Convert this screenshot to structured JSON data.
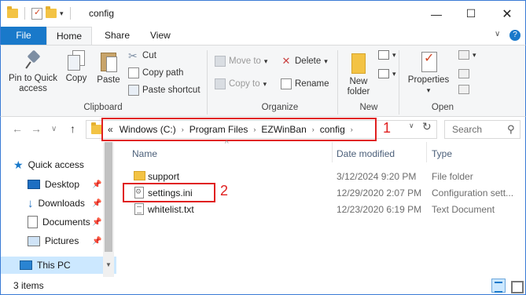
{
  "window": {
    "title": "config",
    "minimize_glyph": "—",
    "maximize_glyph": "☐",
    "close_glyph": "✕"
  },
  "ribbon": {
    "tabs": [
      {
        "label": "File"
      },
      {
        "label": "Home"
      },
      {
        "label": "Share"
      },
      {
        "label": "View"
      }
    ],
    "help_glyph": "?",
    "collapse_glyph": "∨",
    "groups": {
      "clipboard": {
        "label": "Clipboard",
        "pin_to_quick_access": "Pin to Quick access",
        "copy": "Copy",
        "paste": "Paste",
        "cut": "Cut",
        "copy_path": "Copy path",
        "paste_shortcut": "Paste shortcut"
      },
      "organize": {
        "label": "Organize",
        "move_to": "Move to",
        "copy_to": "Copy to",
        "delete": "Delete",
        "rename": "Rename"
      },
      "new": {
        "label": "New",
        "new_folder": "New folder"
      },
      "open": {
        "label": "Open",
        "properties": "Properties"
      }
    }
  },
  "navigation": {
    "back_glyph": "←",
    "forward_glyph": "→",
    "recent_glyph": "∨",
    "up_glyph": "↑",
    "breadcrumb_overflow": "«",
    "breadcrumb": [
      "Windows (C:)",
      "Program Files",
      "EZWinBan",
      "config"
    ],
    "refresh_glyph": "↻",
    "search_placeholder": "Search",
    "search_glyph": "⚲"
  },
  "annotations": {
    "marker_1": "1",
    "marker_2": "2",
    "color": "#e02020"
  },
  "nav_pane": {
    "items": [
      {
        "label": "Quick access",
        "icon": "star-icon"
      },
      {
        "label": "Desktop",
        "icon": "desktop-icon",
        "pinned": true
      },
      {
        "label": "Downloads",
        "icon": "download-icon",
        "pinned": true
      },
      {
        "label": "Documents",
        "icon": "documents-icon",
        "pinned": true
      },
      {
        "label": "Pictures",
        "icon": "pictures-icon",
        "pinned": true
      },
      {
        "label": "This PC",
        "icon": "pc-icon",
        "selected": true
      }
    ],
    "pin_glyph": "📌"
  },
  "file_list": {
    "columns": [
      "Name",
      "Date modified",
      "Type"
    ],
    "rows": [
      {
        "name": "support",
        "date": "3/12/2024 9:20 PM",
        "type": "File folder",
        "icon": "folder-icon"
      },
      {
        "name": "settings.ini",
        "date": "12/29/2020 2:07 PM",
        "type": "Configuration sett...",
        "icon": "ini-file-icon"
      },
      {
        "name": "whitelist.txt",
        "date": "12/23/2020 6:19 PM",
        "type": "Text Document",
        "icon": "text-file-icon"
      }
    ]
  },
  "status_bar": {
    "item_count": "3 items"
  },
  "colors": {
    "accent": "#1979ca",
    "window_border": "#3a7bd5",
    "ribbon_bg": "#f5f6f7",
    "selection": "#cce8ff",
    "folder": "#f3c344"
  }
}
